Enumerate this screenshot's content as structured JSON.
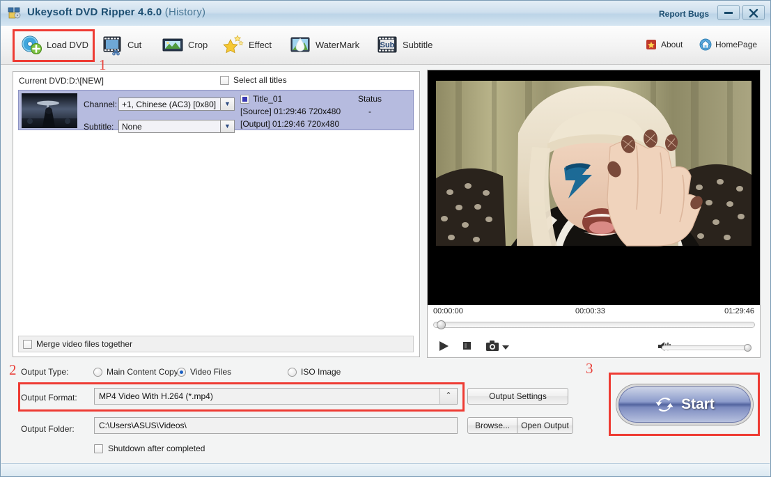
{
  "window": {
    "title": "Ukeysoft DVD Ripper 4.6.0",
    "title_suffix": "(History)",
    "report_bugs": "Report Bugs",
    "minimize_label": "–",
    "close_label": "✕",
    "app_icon": "dvd-ripper-app-icon"
  },
  "toolbar": {
    "items": [
      {
        "label": "Load DVD",
        "icon": "load-dvd-icon"
      },
      {
        "label": "Cut",
        "icon": "cut-film-icon"
      },
      {
        "label": "Crop",
        "icon": "crop-image-icon"
      },
      {
        "label": "Effect",
        "icon": "effect-stars-icon"
      },
      {
        "label": "WaterMark",
        "icon": "watermark-droplet-icon"
      },
      {
        "label": "Subtitle",
        "icon": "subtitle-film-icon"
      }
    ],
    "right_links": [
      {
        "label": "About",
        "icon": "about-star-icon"
      },
      {
        "label": "HomePage",
        "icon": "home-icon"
      }
    ]
  },
  "source_panel": {
    "current_dvd": "Current DVD:D:\\[NEW]",
    "select_all_titles": "Select all titles",
    "channel_label": "Channel:",
    "channel_value": "+1, Chinese (AC3) [0x80]",
    "subtitle_label": "Subtitle:",
    "subtitle_value": "None",
    "title_name": "Title_01",
    "status_header": "Status",
    "status_value": "-",
    "source_row": "[Source]  01:29:46  720x480",
    "output_row": "[Output]  01:29:46  720x480",
    "merge_label": "Merge video files together"
  },
  "preview": {
    "time_start": "00:00:00",
    "time_current": "00:00:33",
    "time_total": "01:29:46",
    "play_icon": "play-icon",
    "stop_icon": "stop-icon",
    "snapshot_icon": "camera-snapshot-icon",
    "snapshot_dropdown_icon": "chevron-down-icon",
    "volume_icon": "volume-speaker-icon"
  },
  "output": {
    "type_label": "Output Type:",
    "types": [
      {
        "label": "Main Content Copy",
        "selected": false
      },
      {
        "label": "Video Files",
        "selected": true
      },
      {
        "label": "ISO Image",
        "selected": false
      }
    ],
    "format_label": "Output Format:",
    "format_value": "MP4 Video With H.264 (*.mp4)",
    "format_caret": "⌃",
    "settings_button": "Output Settings",
    "folder_label": "Output Folder:",
    "folder_value": "C:\\Users\\ASUS\\Videos\\",
    "browse_button": "Browse...",
    "open_output_button": "Open Output",
    "shutdown_label": "Shutdown after completed",
    "start_button": "Start",
    "start_icon": "refresh-cycle-icon"
  },
  "annotations": {
    "markers": [
      "1",
      "2",
      "3"
    ],
    "highlight_color": "#ee3b33"
  }
}
